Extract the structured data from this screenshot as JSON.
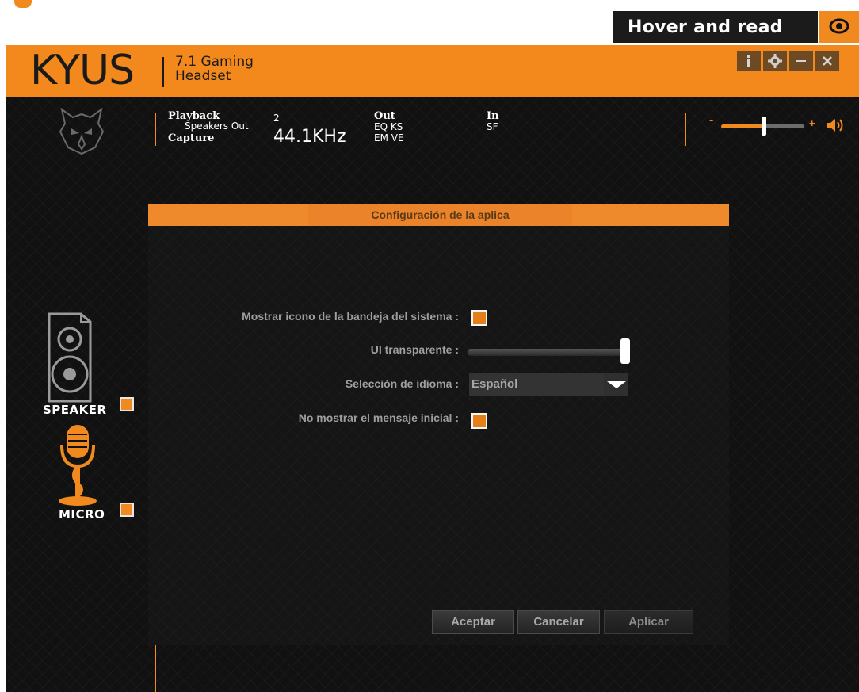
{
  "overlay": {
    "hover_label": "Hover and read",
    "eye_icon": "eye-icon"
  },
  "app": {
    "logo": "KYUS",
    "subtitle_line1": "7.1 Gaming",
    "subtitle_line2": "Headset",
    "window_controls": [
      "info-icon",
      "gear-icon",
      "minimize-icon",
      "close-icon"
    ],
    "accent": "#f08a1e"
  },
  "status": {
    "playback_label": "Playback",
    "playback_device": "Speakers Out",
    "channels": "2",
    "capture_label": "Capture",
    "sample_rate": "44.1KHz",
    "out_label": "Out",
    "out_flags_row1": "EQ  KS",
    "out_flags_row2": "EM  VE",
    "in_label": "In",
    "in_flags": "SF"
  },
  "volume": {
    "minus": "-",
    "plus": "+",
    "level": 0.5
  },
  "sidebar": {
    "speaker_label": "SPEAKER",
    "speaker_checked": true,
    "micro_label": "MICRO",
    "micro_checked": true
  },
  "dialog": {
    "title": "Configuración de la aplica",
    "tray_label": "Mostrar icono de la bandeja del sistema :",
    "tray_checked": true,
    "transparency_label": "UI transparente :",
    "transparency_value": 1.0,
    "language_label": "Selección de idioma :",
    "language_value": "Español",
    "no_intro_label": "No mostrar el mensaje inicial :",
    "no_intro_checked": true,
    "btn_accept": "Aceptar",
    "btn_cancel": "Cancelar",
    "btn_apply": "Aplicar"
  }
}
